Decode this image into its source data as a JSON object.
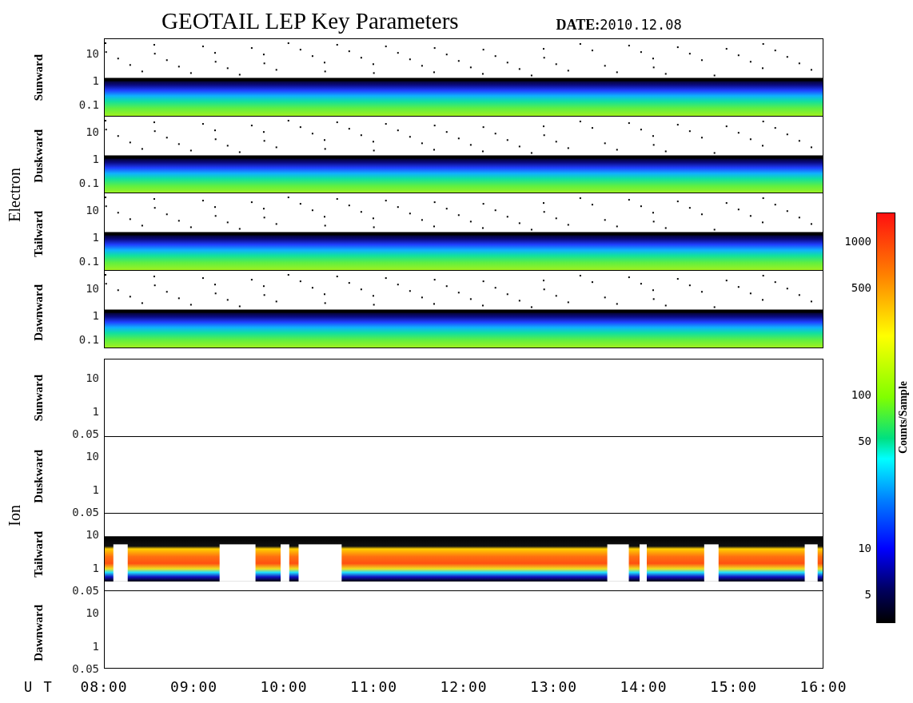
{
  "title": "GEOTAIL LEP Key Parameters",
  "date": {
    "label": "DATE:",
    "value": "2010.12.08"
  },
  "groups": [
    {
      "name": "Electron",
      "panels": [
        {
          "label": "Sunward",
          "kind": "electron",
          "yticks": [
            "10",
            "1",
            "0.1"
          ]
        },
        {
          "label": "Duskward",
          "kind": "electron",
          "yticks": [
            "10",
            "1",
            "0.1"
          ]
        },
        {
          "label": "Tailward",
          "kind": "electron",
          "yticks": [
            "10",
            "1",
            "0.1"
          ]
        },
        {
          "label": "Dawnward",
          "kind": "electron",
          "yticks": [
            "10",
            "1",
            "0.1"
          ]
        }
      ]
    },
    {
      "name": "Ion",
      "panels": [
        {
          "label": "Sunward",
          "kind": "empty",
          "yticks": [
            "10",
            "1",
            "0.05"
          ]
        },
        {
          "label": "Duskward",
          "kind": "empty",
          "yticks": [
            "10",
            "1",
            "0.05"
          ]
        },
        {
          "label": "Tailward",
          "kind": "ion",
          "yticks": [
            "10",
            "1",
            "0.05"
          ]
        },
        {
          "label": "Dawnward",
          "kind": "empty",
          "yticks": [
            "10",
            "1",
            "0.05"
          ]
        }
      ]
    }
  ],
  "colorbar": {
    "title": "Counts/Sample",
    "ticks": [
      "1000",
      "500",
      "100",
      "50",
      "10",
      "5"
    ]
  },
  "xaxis": {
    "label": "U T",
    "ticks": [
      "08:00",
      "09:00",
      "10:00",
      "11:00",
      "12:00",
      "13:00",
      "14:00",
      "15:00",
      "16:00"
    ]
  }
}
